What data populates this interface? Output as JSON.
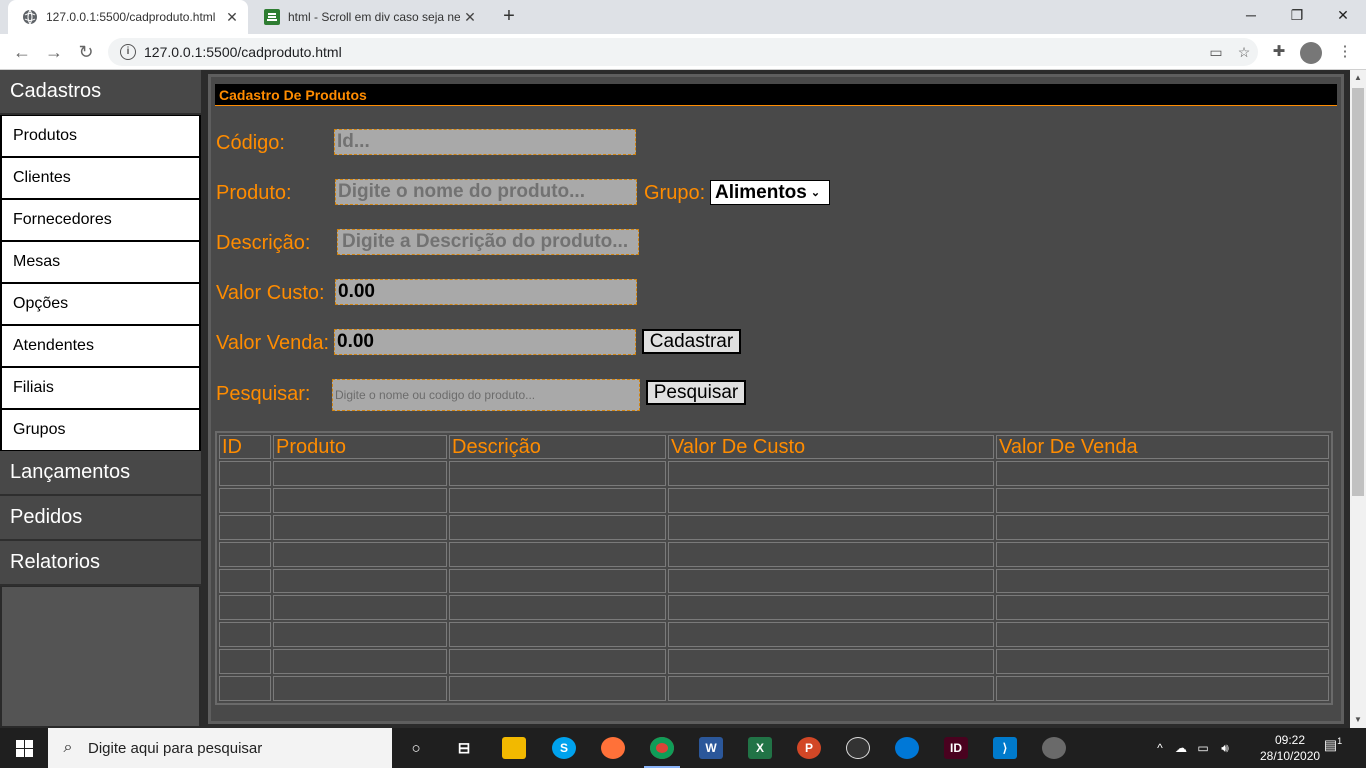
{
  "browser": {
    "tabs": [
      {
        "title": "127.0.0.1:5500/cadproduto.html",
        "active": true
      },
      {
        "title": "html - Scroll em div caso seja nec",
        "active": false
      }
    ],
    "new_tab": "+",
    "url": "127.0.0.1:5500/cadproduto.html",
    "window": {
      "minimize": "─",
      "restore": "❐",
      "close": "✕"
    }
  },
  "sidebar": {
    "sections": [
      {
        "label": "Cadastros",
        "items": [
          "Produtos",
          "Clientes",
          "Fornecedores",
          "Mesas",
          "Opções",
          "Atendentes",
          "Filiais",
          "Grupos"
        ]
      },
      {
        "label": "Lançamentos"
      },
      {
        "label": "Pedidos"
      },
      {
        "label": "Relatorios"
      }
    ]
  },
  "form": {
    "header": "Cadastro De Produtos",
    "codigo": {
      "label": "Código:",
      "placeholder": "Id..."
    },
    "produto": {
      "label": "Produto:",
      "placeholder": "Digite o nome do produto..."
    },
    "grupo": {
      "label": "Grupo:",
      "selected": "Alimentos"
    },
    "descricao": {
      "label": "Descrição:",
      "placeholder": "Digite a Descrição do produto..."
    },
    "valor_custo": {
      "label": "Valor Custo:",
      "value": "0.00"
    },
    "valor_venda": {
      "label": "Valor Venda:",
      "value": "0.00"
    },
    "cadastrar_button": "Cadastrar",
    "pesquisar": {
      "label": "Pesquisar:",
      "placeholder": "Digite o nome ou codigo do produto..."
    },
    "pesquisar_button": "Pesquisar"
  },
  "table": {
    "columns": [
      "ID",
      "Produto",
      "Descrição",
      "Valor De Custo",
      "Valor De Venda"
    ],
    "empty_rows": 9
  },
  "taskbar": {
    "search_placeholder": "Digite aqui para pesquisar",
    "time": "09:22",
    "date": "28/10/2020",
    "notification_count": "1"
  },
  "colors": {
    "accent": "#ff8c00",
    "panel": "#494949",
    "sidebar": "#484848"
  }
}
